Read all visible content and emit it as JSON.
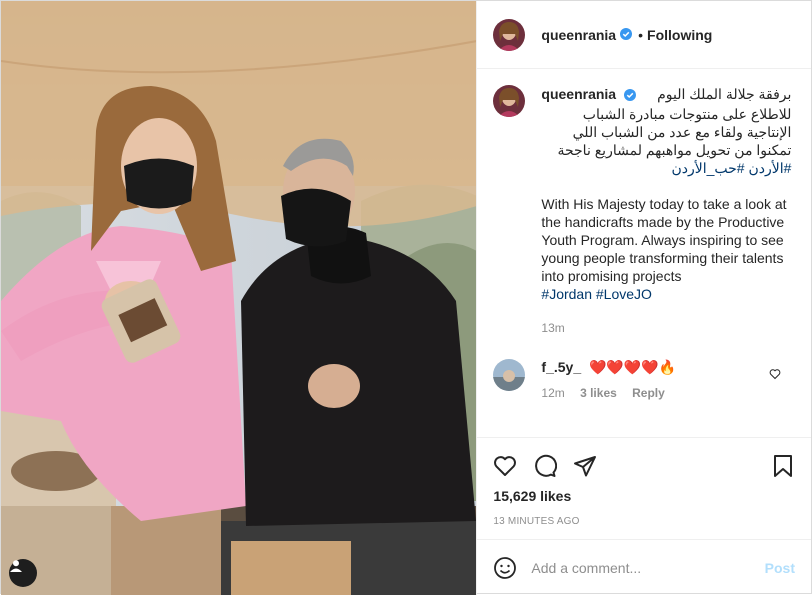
{
  "header": {
    "username": "queenrania",
    "separator": "•",
    "follow_status": "Following"
  },
  "caption": {
    "username": "queenrania",
    "arabic_line1": "برفقة جلالة الملك اليوم",
    "arabic_line2": "للاطلاع على منتوجات مبادرة الشباب",
    "arabic_line3": "الإنتاجية ولقاء مع عدد من الشباب اللي",
    "arabic_line4": "تمكنوا من تحويل مواهبهم لمشاريع ناجحة",
    "arabic_tags": "#الأردن #حب_الأردن",
    "english": "With His Majesty today to take a look at the handicrafts made by the Productive Youth Program. Always inspiring to see young people transforming their talents into promising projects",
    "english_tags": "#Jordan #LoveJO",
    "time": "13m"
  },
  "comment": {
    "username": "f_.5y_",
    "text": "❤️❤️❤️❤️🔥",
    "time": "12m",
    "likes": "3 likes",
    "reply": "Reply"
  },
  "post": {
    "likes": "15,629 likes",
    "posted": "13 MINUTES AGO"
  },
  "add_comment": {
    "placeholder": "Add a comment...",
    "post_label": "Post"
  },
  "colors": {
    "verified": "#3897f0",
    "link": "#00376b",
    "post_button_disabled": "#b2dffc",
    "heart_red": "#ed4956"
  },
  "icons": [
    "verified-badge-icon",
    "heart-icon",
    "comment-icon",
    "share-icon",
    "bookmark-icon",
    "emoji-icon",
    "tag-user-icon"
  ]
}
